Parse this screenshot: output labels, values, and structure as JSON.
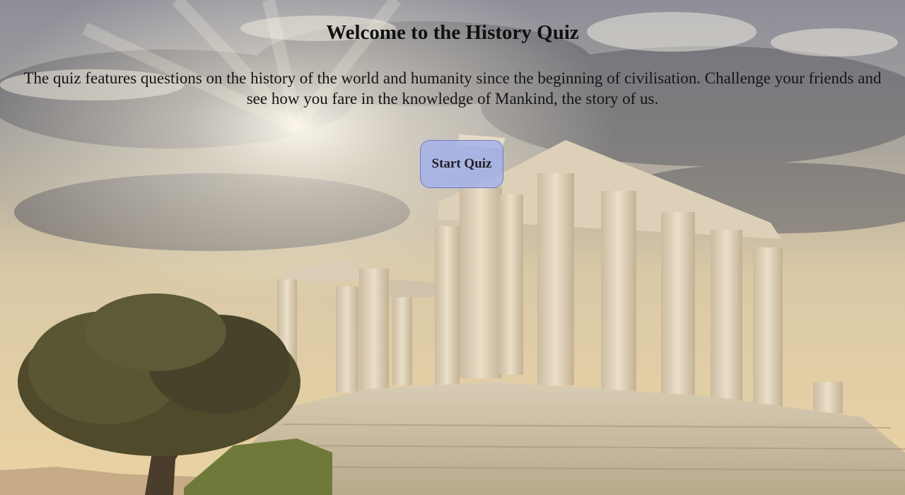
{
  "page": {
    "title": "Welcome to the History Quiz",
    "intro": "The quiz features questions on the history of the world and humanity since the beginning of civilisation. Challenge your friends and see how you fare in the knowledge of Mankind, the story of us.",
    "start_button_label": "Start Quiz"
  },
  "background": {
    "image": "temple-of-poseidon-photo",
    "sky_color": "#c9c2b3",
    "cloud_color": "#6d6c71",
    "stone_color": "#e0d2b9",
    "tree_color": "#4f4a2c"
  },
  "colors": {
    "button_fill": "#a8b4f0",
    "button_border": "#6d7cc0",
    "text": "#111111"
  }
}
